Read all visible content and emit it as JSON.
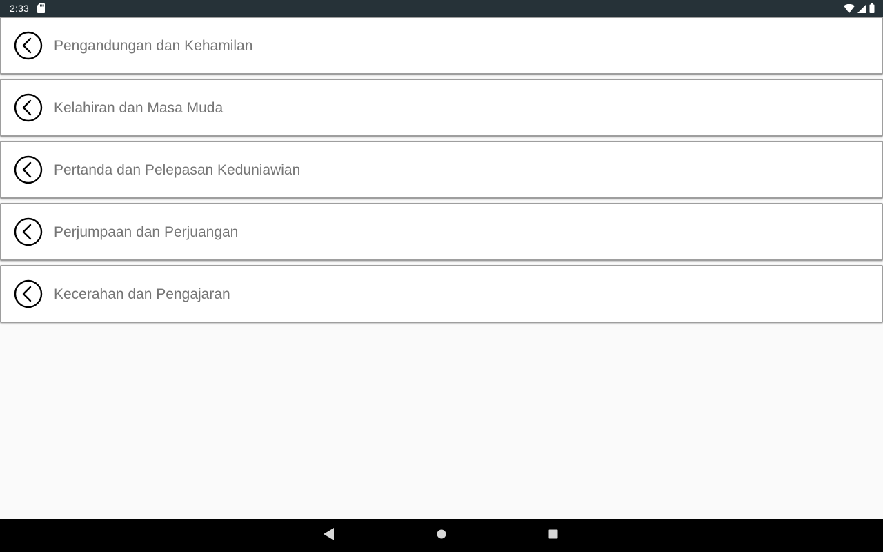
{
  "status_bar": {
    "time": "2:33",
    "left_icons": [
      "sd-card-icon"
    ],
    "right_icons": [
      "wifi-icon",
      "cell-signal-icon",
      "battery-icon"
    ],
    "background_color": "#263238"
  },
  "list": {
    "items": [
      {
        "label": "Pengandungan dan Kehamilan",
        "icon": "chevron-left-circle-icon"
      },
      {
        "label": "Kelahiran dan Masa Muda",
        "icon": "chevron-left-circle-icon"
      },
      {
        "label": "Pertanda dan Pelepasan Keduniawian",
        "icon": "chevron-left-circle-icon"
      },
      {
        "label": "Perjumpaan dan Perjuangan",
        "icon": "chevron-left-circle-icon"
      },
      {
        "label": "Kecerahan dan Pengajaran",
        "icon": "chevron-left-circle-icon"
      }
    ],
    "text_color": "#757575",
    "border_color": "#9e9e9e"
  },
  "nav_bar": {
    "buttons": [
      "back-icon",
      "home-icon",
      "recents-icon"
    ],
    "background_color": "#000000"
  }
}
